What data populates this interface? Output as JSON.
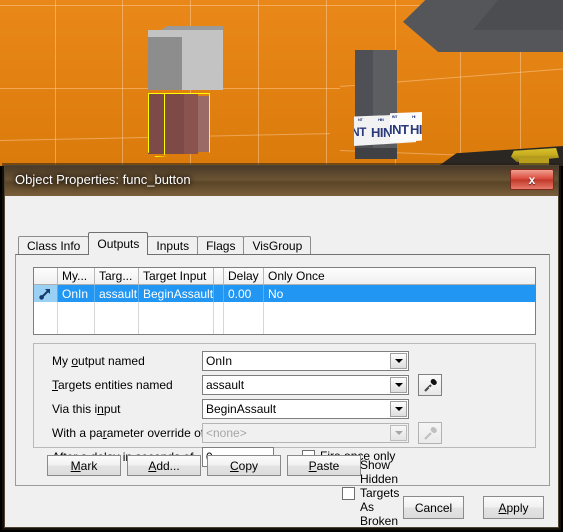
{
  "viewport": {
    "name": "3d-viewport",
    "hint_texture_labels": [
      "NT",
      "HIN",
      "INT",
      "HI"
    ],
    "colors": {
      "wall": "#E8820C",
      "grid": "#FFD7AA",
      "selection_outline": "#FFFF00",
      "brush_top": "#C3C3C3",
      "brush_bottom": "#8A5350"
    }
  },
  "dialog": {
    "title": "Object Properties: func_button",
    "close_label": "x",
    "tabs": [
      {
        "label": "Class Info",
        "active": false
      },
      {
        "label": "Outputs",
        "active": true
      },
      {
        "label": "Inputs",
        "active": false
      },
      {
        "label": "Flags",
        "active": false
      },
      {
        "label": "VisGroup",
        "active": false
      }
    ],
    "outputs_list": {
      "columns": [
        "",
        "My...",
        "Targ...",
        "Target Input",
        "",
        "Delay",
        "Only Once"
      ],
      "rows": [
        {
          "icon": "output-arrow-icon",
          "my_output": "OnIn",
          "target": "assault",
          "target_input": "BeginAssault",
          "spacer": "",
          "delay": "0.00",
          "only_once": "No",
          "selected": true
        }
      ],
      "empty_rows": 2
    },
    "form": {
      "output_named": {
        "label_pre": "My ",
        "label_accel": "o",
        "label_post": "utput named",
        "value": "OnIn"
      },
      "targets_named": {
        "label_pre": "",
        "label_accel": "T",
        "label_post": "argets entities named",
        "value": "assault",
        "picker_icon": "eyedropper-icon"
      },
      "via_input": {
        "label_pre": "Via this i",
        "label_accel": "n",
        "label_post": "put",
        "value": "BeginAssault"
      },
      "param_override": {
        "label_pre": "With a pa",
        "label_accel": "r",
        "label_post": "ameter override of",
        "value": "<none>",
        "disabled": true,
        "picker_icon": "eyedropper-icon"
      },
      "delay": {
        "label_pre": "After a de",
        "label_accel": "l",
        "label_post": "ay in seconds of",
        "value": "0"
      },
      "fire_once": {
        "label_pre": "",
        "label_accel": "F",
        "label_post": "ire once only",
        "checked": false
      }
    },
    "action_buttons": [
      {
        "pre": "",
        "accel": "M",
        "post": "ark"
      },
      {
        "pre": "",
        "accel": "A",
        "post": "dd..."
      },
      {
        "pre": "",
        "accel": "C",
        "post": "opy"
      },
      {
        "pre": "",
        "accel": "P",
        "post": "aste"
      }
    ],
    "show_hidden": {
      "label": "Show Hidden Targets As Broken",
      "checked": false
    },
    "footer_buttons": [
      {
        "pre": "",
        "accel": "",
        "post": "Cancel"
      },
      {
        "pre": "",
        "accel": "A",
        "post": "pply"
      }
    ]
  }
}
